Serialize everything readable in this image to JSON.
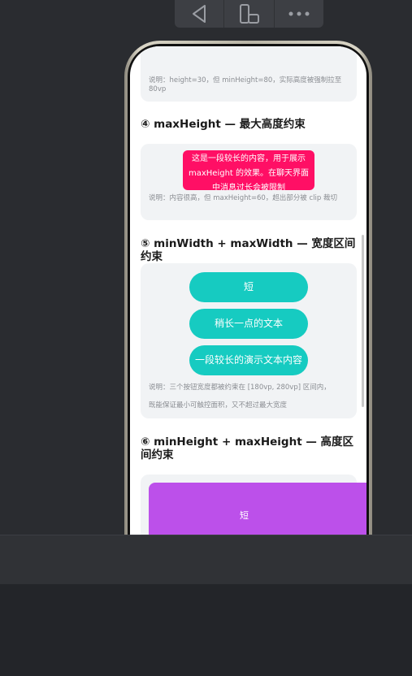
{
  "toolbar": {
    "buttons": [
      {
        "icon": "back-triangle-icon"
      },
      {
        "icon": "rotate-device-icon"
      },
      {
        "icon": "more-dots-icon"
      }
    ]
  },
  "sections": {
    "s3": {
      "note": "说明：height=30，但 minHeight=80，实际高度被强制拉至 80vp"
    },
    "s4": {
      "title": "④ maxHeight — 最大高度约束",
      "box_text": "这是一段较长的内容，用于展示 maxHeight 的效果。在聊天界面中消息过长会被限制",
      "note": "说明：内容很高，但 maxHeight=60，超出部分被 clip 裁切"
    },
    "s5": {
      "title": "⑤ minWidth + maxWidth — 宽度区间约束",
      "buttons": [
        "短",
        "稍长一点的文本",
        "一段较长的演示文本内容"
      ],
      "note_line1": "说明：三个按钮宽度都被约束在 [180vp, 280vp] 区间内，",
      "note_line2": "既能保证最小可触控面积，又不超过最大宽度"
    },
    "s6": {
      "title": "⑥ minHeight + maxHeight — 高度区间约束",
      "box_text": "短"
    }
  },
  "colors": {
    "pink": "#ff0f65",
    "teal": "#16cbc1",
    "purple": "#bc50ea"
  }
}
